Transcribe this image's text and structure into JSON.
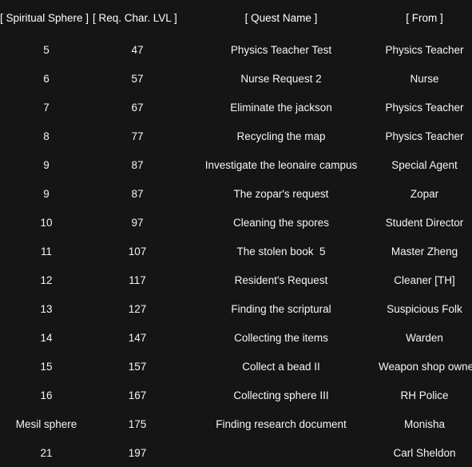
{
  "table": {
    "headers": [
      "[ Spiritual Sphere ]",
      "[ Req. Char. LVL ]",
      "[ Quest Name ]",
      "[ From ]"
    ],
    "rows": [
      {
        "sphere": "5",
        "lvl": "47",
        "quest": "Physics Teacher Test",
        "from": "Physics Teacher"
      },
      {
        "sphere": "6",
        "lvl": "57",
        "quest": "Nurse Request 2",
        "from": "Nurse"
      },
      {
        "sphere": "7",
        "lvl": "67",
        "quest": "Eliminate the jackson",
        "from": "Physics Teacher"
      },
      {
        "sphere": "8",
        "lvl": "77",
        "quest": "Recycling the map",
        "from": "Physics Teacher"
      },
      {
        "sphere": "9",
        "lvl": "87",
        "quest": "Investigate the leonaire campus",
        "from": "Special Agent"
      },
      {
        "sphere": "9",
        "lvl": "87",
        "quest": "The zopar's request",
        "from": "Zopar"
      },
      {
        "sphere": "10",
        "lvl": "97",
        "quest": "Cleaning the spores",
        "from": "Student Director"
      },
      {
        "sphere": "11",
        "lvl": "107",
        "quest": "The stolen book  5",
        "from": "Master Zheng"
      },
      {
        "sphere": "12",
        "lvl": "117",
        "quest": "Resident's Request",
        "from": "Cleaner [TH]"
      },
      {
        "sphere": "13",
        "lvl": "127",
        "quest": "Finding the scriptural",
        "from": "Suspicious Folk"
      },
      {
        "sphere": "14",
        "lvl": "147",
        "quest": "Collecting the items",
        "from": "Warden"
      },
      {
        "sphere": "15",
        "lvl": "157",
        "quest": "Collect a bead II",
        "from": "Weapon shop owner"
      },
      {
        "sphere": "16",
        "lvl": "167",
        "quest": "Collecting sphere III",
        "from": "RH Police"
      },
      {
        "sphere": "Mesil sphere",
        "lvl": "175",
        "quest": "Finding research document",
        "from": "Monisha"
      },
      {
        "sphere": "21",
        "lvl": "197",
        "quest": "",
        "from": "Carl Sheldon"
      }
    ]
  },
  "colors": {
    "background": "#151515",
    "text": "#f5f5f5",
    "header_text": "#ffffff"
  }
}
